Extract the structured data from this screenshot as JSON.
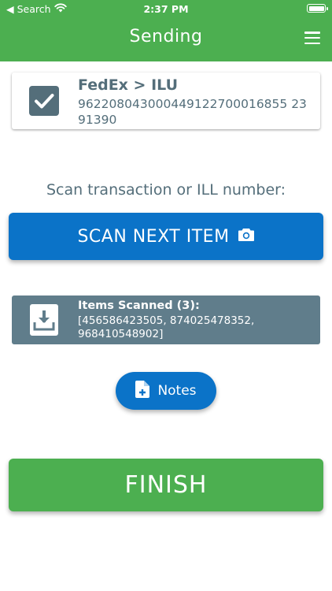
{
  "status_bar": {
    "back_label": "◀ Search",
    "time": "2:37 PM"
  },
  "header": {
    "title": "Sending"
  },
  "shipment": {
    "carrier_route": "FedEx > ILU",
    "tracking_number": "962208043000449122700016855 2391390"
  },
  "scan": {
    "prompt": "Scan transaction or ILL number:",
    "button_label": "SCAN NEXT ITEM"
  },
  "items_scanned": {
    "heading": "Items Scanned (3):",
    "list_text": "[456586423505, 874025478352, 968410548902]"
  },
  "notes": {
    "button_label": "Notes"
  },
  "finish": {
    "button_label": "FINISH"
  },
  "colors": {
    "header_green": "#4caf50",
    "primary_blue": "#0b73c8",
    "slate": "#546e7a",
    "scanned_panel": "#607d8b"
  },
  "icons": [
    "wifi-icon",
    "battery-icon",
    "menu-icon",
    "checkbox-checked-icon",
    "camera-icon",
    "inbox-download-icon",
    "note-add-icon"
  ]
}
